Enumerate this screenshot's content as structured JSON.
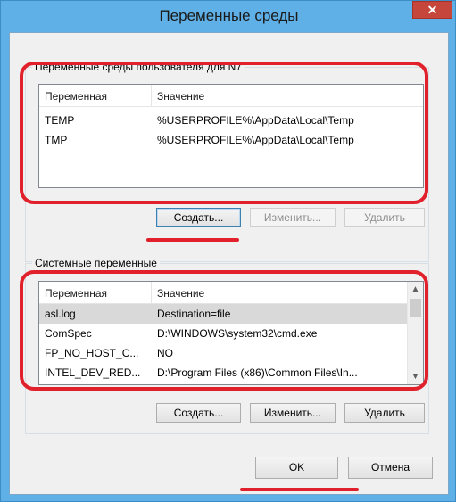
{
  "window": {
    "title": "Переменные среды",
    "close_glyph": "✕"
  },
  "user_group": {
    "label": "Переменные среды пользователя для N7",
    "columns": [
      "Переменная",
      "Значение"
    ],
    "rows": [
      {
        "name": "TEMP",
        "value": "%USERPROFILE%\\AppData\\Local\\Temp"
      },
      {
        "name": "TMP",
        "value": "%USERPROFILE%\\AppData\\Local\\Temp"
      }
    ],
    "buttons": {
      "new": "Создать...",
      "edit": "Изменить...",
      "delete": "Удалить"
    },
    "disabled": [
      "edit",
      "delete"
    ]
  },
  "system_group": {
    "label": "Системные переменные",
    "columns": [
      "Переменная",
      "Значение"
    ],
    "rows": [
      {
        "name": "asl.log",
        "value": "Destination=file",
        "selected": true
      },
      {
        "name": "ComSpec",
        "value": "D:\\WINDOWS\\system32\\cmd.exe"
      },
      {
        "name": "FP_NO_HOST_C...",
        "value": "NO"
      },
      {
        "name": "INTEL_DEV_RED...",
        "value": "D:\\Program Files (x86)\\Common Files\\In..."
      }
    ],
    "buttons": {
      "new": "Создать...",
      "edit": "Изменить...",
      "delete": "Удалить"
    }
  },
  "footer": {
    "ok": "OK",
    "cancel": "Отмена"
  },
  "colors": {
    "highlight": "#e0202a",
    "selection": "#d9d9d9",
    "frame": "#5fb0e6"
  },
  "icons": {
    "scroll_up": "▲",
    "scroll_down": "▼"
  }
}
